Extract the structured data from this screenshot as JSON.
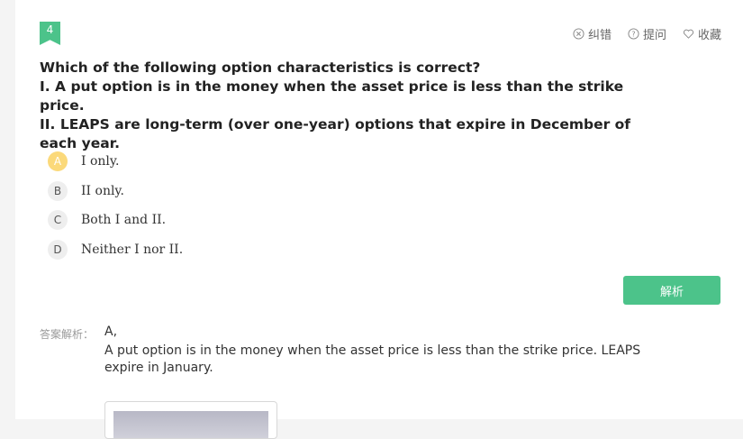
{
  "question_number": "4",
  "actions": [
    {
      "label": "纠错",
      "icon": "x-circle-icon"
    },
    {
      "label": "提问",
      "icon": "question-circle-icon"
    },
    {
      "label": "收藏",
      "icon": "heart-icon"
    }
  ],
  "question": {
    "line1": "Which of the following option characteristics is correct?",
    "line2": "I. A put option is in the money when the asset price is less than the strike price.",
    "line3": "II. LEAPS are long-term (over one-year) options that expire in December of each year."
  },
  "options": [
    {
      "letter": "A",
      "text": "I only.",
      "selected": true
    },
    {
      "letter": "B",
      "text": "II only.",
      "selected": false
    },
    {
      "letter": "C",
      "text": "Both I and II.",
      "selected": false
    },
    {
      "letter": "D",
      "text": "Neither I nor II.",
      "selected": false
    }
  ],
  "analyze_button": "解析",
  "answer": {
    "label": "答案解析：",
    "value": "A,",
    "explanation": "A put option is in the money when the asset price is less than the strike price. LEAPS expire in January."
  },
  "colors": {
    "accent": "#4cc38a",
    "selected_option": "#fbd97a"
  }
}
